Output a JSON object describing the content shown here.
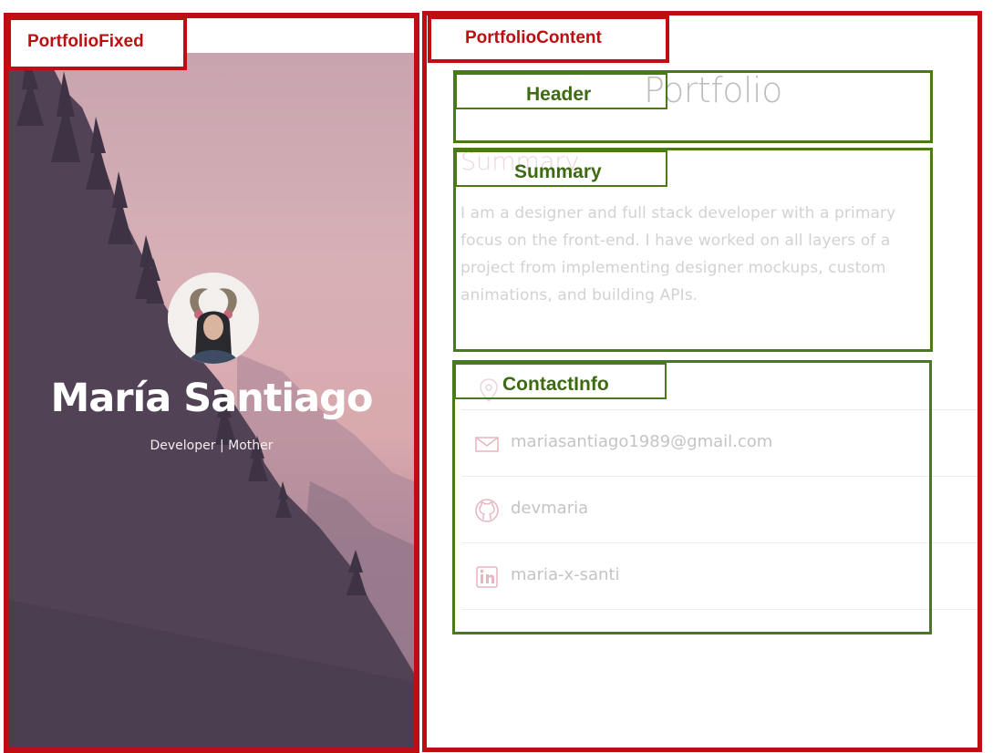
{
  "profile": {
    "name": "María Santiago",
    "tagline": "Developer | Mother"
  },
  "header": {
    "title": "Portfolio"
  },
  "summary": {
    "heading": "Summary",
    "text": "I am a designer and full stack developer with a primary focus on the front-end. I have worked on all layers of a project from implementing designer mockups, custom animations, and building APIs."
  },
  "contact": {
    "items": [
      {
        "icon": "email-icon",
        "value": "mariasantiago1989@gmail.com"
      },
      {
        "icon": "github-icon",
        "value": "devmaria"
      },
      {
        "icon": "linkedin-icon",
        "value": "maria-x-santi"
      }
    ]
  },
  "annotations": {
    "portfolio_fixed": "PortfolioFixed",
    "portfolio_content": "PortfolioContent",
    "header": "Header",
    "summary": "Summary",
    "contact_info": "ContactInfo"
  },
  "colors": {
    "annotation_red": "#c00d12",
    "annotation_green": "#4a7a17",
    "icon_pink": "#e8b4bf"
  }
}
